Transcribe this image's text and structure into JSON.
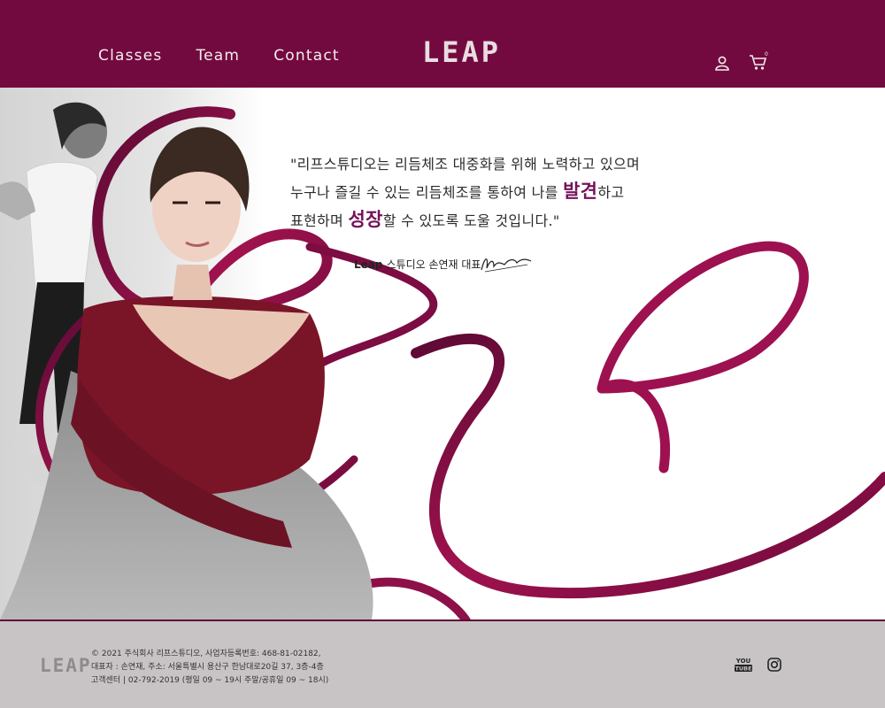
{
  "header": {
    "nav": [
      "Classes",
      "Team",
      "Contact"
    ],
    "logo": "LEAP",
    "icons": [
      "user-icon",
      "cart-icon"
    ],
    "cart_count": "0",
    "background": "#730a3f"
  },
  "hero": {
    "quote_line1": "\"리프스튜디오는 리듬체조 대중화를 위해 노력하고 있으며",
    "quote_line2_a": "누구나 즐길 수 있는 리듬체조를 통하여 나를 ",
    "quote_line2_em": "발견",
    "quote_line2_b": "하고",
    "quote_line3_a": "표현하며 ",
    "quote_line3_em": "성장",
    "quote_line3_b": "할 수 있도록 도울 것입니다.\"",
    "sign_brand": "Leap",
    "sign_text": "스튜디오 손연재 대표",
    "accent": "#75125a"
  },
  "footer": {
    "logo": "LEAP",
    "line1": "© 2021 주식회사 리프스튜디오, 사업자등록번호: 468-81-02182,",
    "line2": "대표자 : 손연재, 주소: 서울특별시 용산구 한남대로20길 37, 3층-4층",
    "line3": "고객센터 | 02-792-2019 (평일 09 ~ 19시 주말/공휴일 09 ~ 18시)",
    "icons": [
      "youtube-icon",
      "instagram-icon"
    ],
    "background": "#c8c4c6"
  }
}
